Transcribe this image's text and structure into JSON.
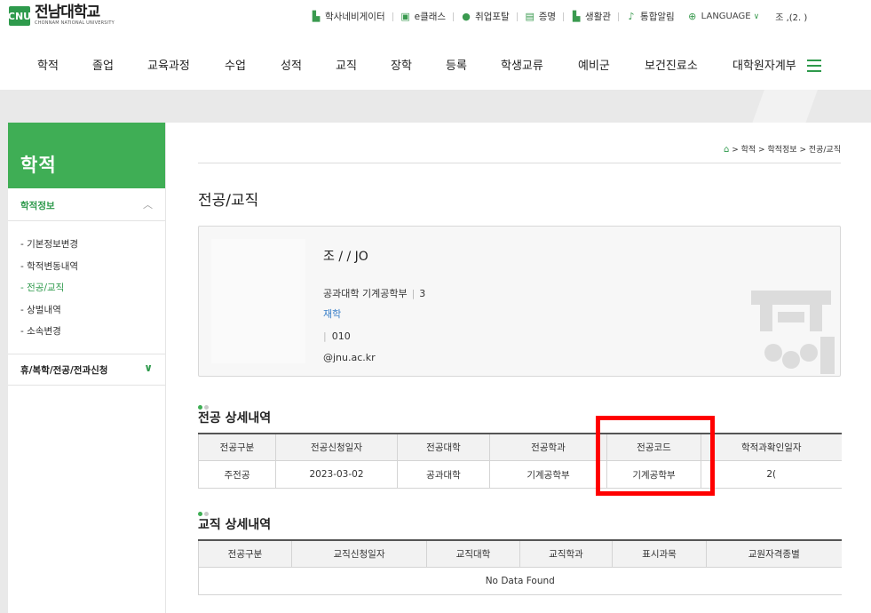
{
  "logo": {
    "mark": "CNU",
    "name_kr": "전남대학교",
    "name_en": "CHONNAM NATIONAL UNIVERSITY"
  },
  "utility": {
    "items": [
      {
        "icon": "building-icon",
        "label": "학사네비게이터"
      },
      {
        "icon": "calendar-icon",
        "label": "e클래스"
      },
      {
        "icon": "people-icon",
        "label": "취업포탈"
      },
      {
        "icon": "document-icon",
        "label": "증명"
      },
      {
        "icon": "building-icon",
        "label": "생활관"
      },
      {
        "icon": "bell-icon",
        "label": "통합알림"
      }
    ],
    "language": "LANGUAGE",
    "user": "조      ,(2.        )"
  },
  "nav": {
    "items": [
      "학적",
      "졸업",
      "교육과정",
      "수업",
      "성적",
      "교직",
      "장학",
      "등록",
      "학생교류",
      "예비군",
      "보건진료소",
      "대학원자계부"
    ]
  },
  "sidebar": {
    "title": "학적",
    "section1": "학적정보",
    "items": [
      "- 기본정보변경",
      "- 학적변동내역",
      "- 전공/교직",
      "- 상벌내역",
      "- 소속변경"
    ],
    "active_index": 2,
    "section2": "휴/복학/전공/전과신청"
  },
  "breadcrumb": {
    "home_icon": "home-icon",
    "text": "> 학적 > 학적정보 > 전공/교직"
  },
  "page": {
    "title": "전공/교직"
  },
  "profile": {
    "name": "조      / / JO",
    "college": "공과대학 기계공학부",
    "year": "3",
    "status": "재학",
    "phone": "010",
    "email": "         @jnu.ac.kr"
  },
  "major": {
    "title": "전공 상세내역",
    "headers": [
      "전공구분",
      "전공신청일자",
      "전공대학",
      "전공학과",
      "전공코드",
      "학적과확인일자"
    ],
    "rows": [
      [
        "주전공",
        "2023-03-02",
        "공과대학",
        "기계공학부",
        "기계공학부",
        "2("
      ]
    ]
  },
  "teaching": {
    "title": "교직 상세내역",
    "headers": [
      "전공구분",
      "교직신청일자",
      "교직대학",
      "교직학과",
      "표시과목",
      "교원자격종별"
    ],
    "empty": "No Data Found"
  },
  "colors": {
    "brand_green": "#3fae55",
    "link_blue": "#3a7fc8",
    "highlight_red": "#ff0000"
  }
}
